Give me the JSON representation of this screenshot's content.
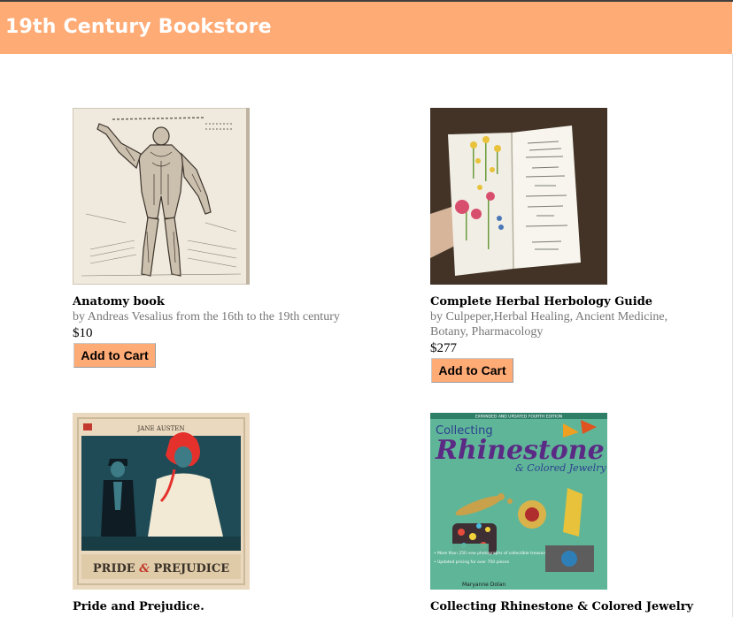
{
  "header": {
    "title": "19th Century Bookstore",
    "background": "#ffab76"
  },
  "products": [
    {
      "title": "Anatomy book",
      "author": "by Andreas Vesalius from the 16th to the 19th century",
      "price": "$10",
      "button": "Add to Cart",
      "image": "anatomy-engraving"
    },
    {
      "title": "Complete Herbal Herbology Guide",
      "author": "by Culpeper,Herbal Healing, Ancient Medicine, Botany, Pharmacology",
      "price": "$277",
      "button": "Add to Cart",
      "image": "open-herbal-book"
    },
    {
      "title": "Pride and Prejudice.",
      "image": "pride-prejudice-cover"
    },
    {
      "title": "Collecting Rhinestone & Colored Jewelry",
      "image": "rhinestone-jewelry-cover"
    }
  ],
  "covers": {
    "pride_author": "JANE AUSTEN",
    "pride_title_left": "PRIDE",
    "pride_title_amp": "&",
    "pride_title_right": "PREJUDICE",
    "rhine_banner": "EXPANDED AND UPDATED FOURTH EDITION",
    "rhine_line1": "Collecting",
    "rhine_line2": "Rhinestone",
    "rhine_line3": "& Colored Jewelry",
    "rhine_bullet1": "• More than 250 new photographs of collectible treasures",
    "rhine_bullet2": "• Updated pricing for over 750 pieces",
    "rhine_author": "Maryanne Dolan"
  }
}
